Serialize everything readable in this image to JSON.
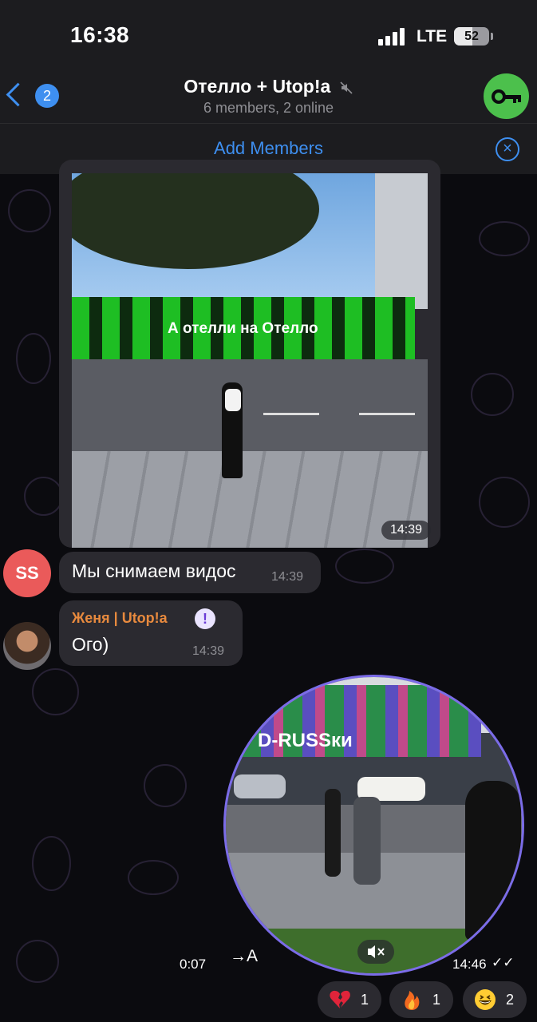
{
  "status_bar": {
    "time": "16:38",
    "network": "LTE",
    "battery": "52",
    "battery_level": 0.52
  },
  "header": {
    "back_count": "2",
    "title": "Отелло + Utop!a",
    "subtitle": "6 members, 2 online",
    "title_icon": "muted-speaker-icon",
    "right_button_icon": "key-icon"
  },
  "add_members_bar": {
    "label": "Add Members",
    "close_icon": "close-circle-icon"
  },
  "messages": [
    {
      "type": "photo",
      "photo_text": "А отелли на Отелло",
      "time": "14:39"
    },
    {
      "type": "text",
      "avatar_initials": "SS",
      "text": "Мы снимаем видос",
      "time": "14:39"
    },
    {
      "type": "text",
      "sender": "Женя | Utop!a",
      "sender_badge": "!",
      "text": "Ого)",
      "time": "14:39"
    },
    {
      "type": "round_video",
      "video_text": "D-RUSSки",
      "duration": "0:07",
      "translate_label": "→A",
      "time": "14:46",
      "read_status": "✓✓"
    }
  ],
  "reactions": [
    {
      "emoji": "broken-heart-icon",
      "count": "1"
    },
    {
      "emoji": "fire-icon",
      "count": "1"
    },
    {
      "emoji": "grinning-face-icon",
      "count": "2"
    }
  ],
  "colors": {
    "accent": "#3e8ff0",
    "key_button": "#4cc04c",
    "avatar_ss": "#ea5a5a",
    "sender_name": "#e88a3e",
    "bubble": "#2b2a30",
    "video_ring": "#7b6ce8"
  }
}
